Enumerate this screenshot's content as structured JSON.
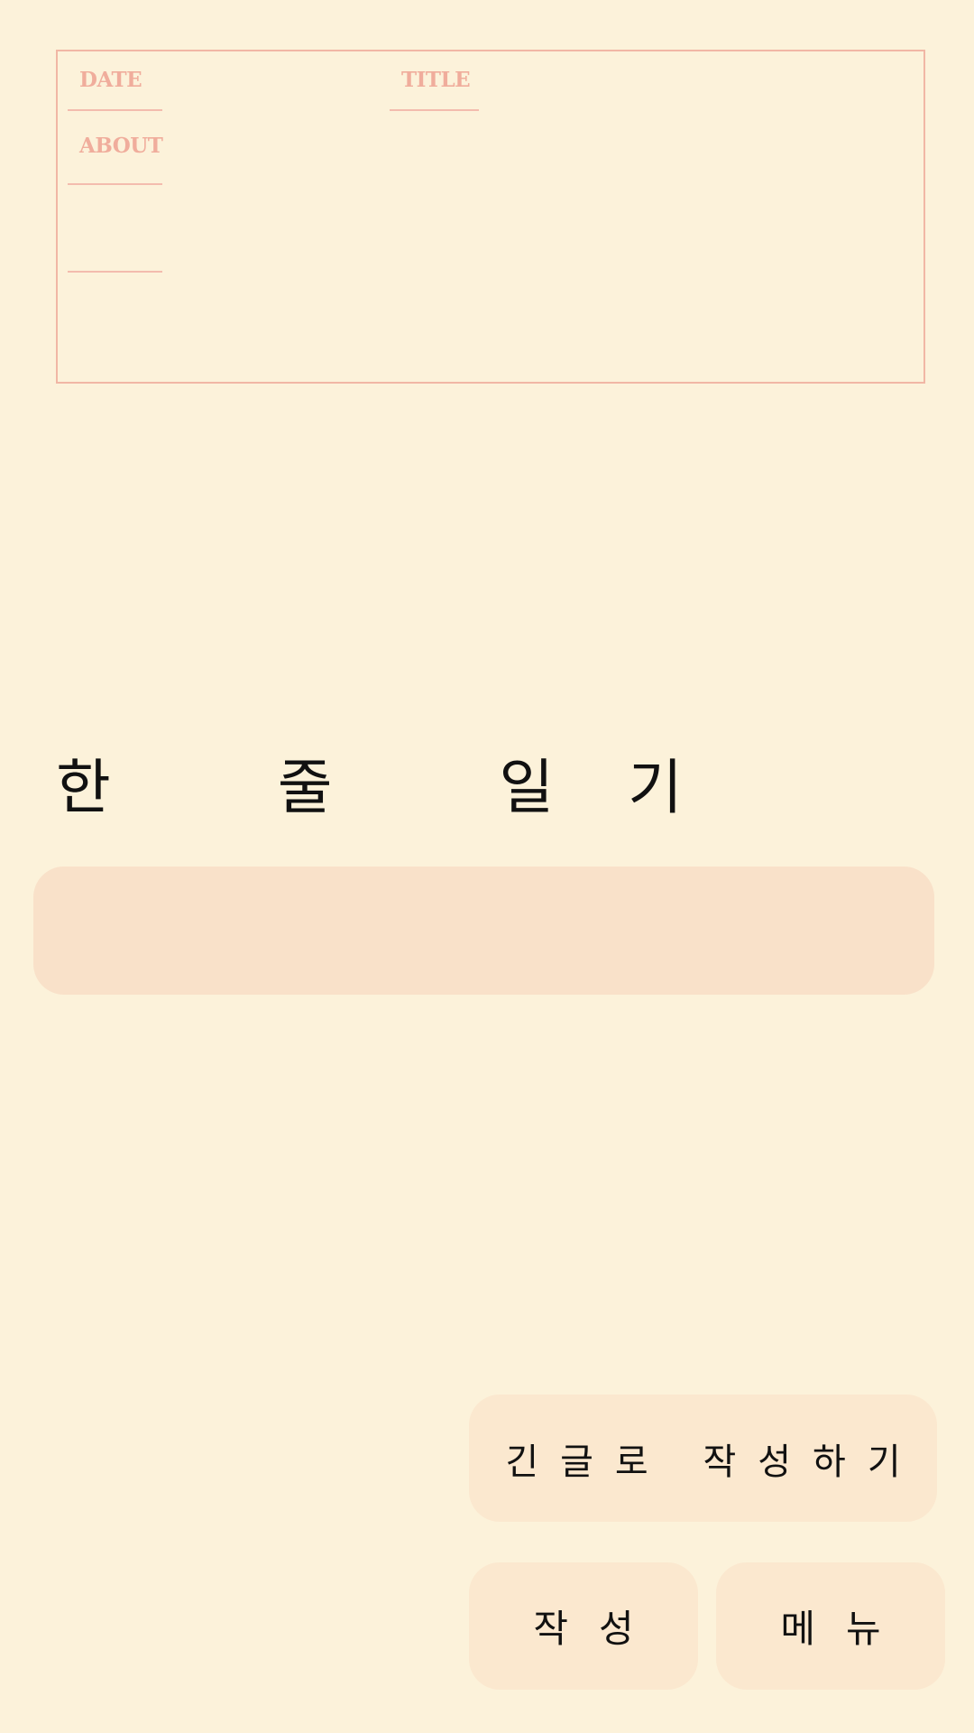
{
  "header": {
    "date_label": "DATE",
    "title_label": "TITLE",
    "about_label": "ABOUT"
  },
  "diary": {
    "title": "한 줄 일기",
    "input_value": "",
    "input_placeholder": ""
  },
  "buttons": {
    "long_write_label": "긴글로 작성하기",
    "write_label": "작성",
    "menu_label": "메뉴"
  },
  "colors": {
    "background": "#fcf2da",
    "header_accent": "#f0ad9c",
    "input_bg": "#f9e1c9",
    "button_bg": "#fbe8cf",
    "text": "#111111"
  }
}
